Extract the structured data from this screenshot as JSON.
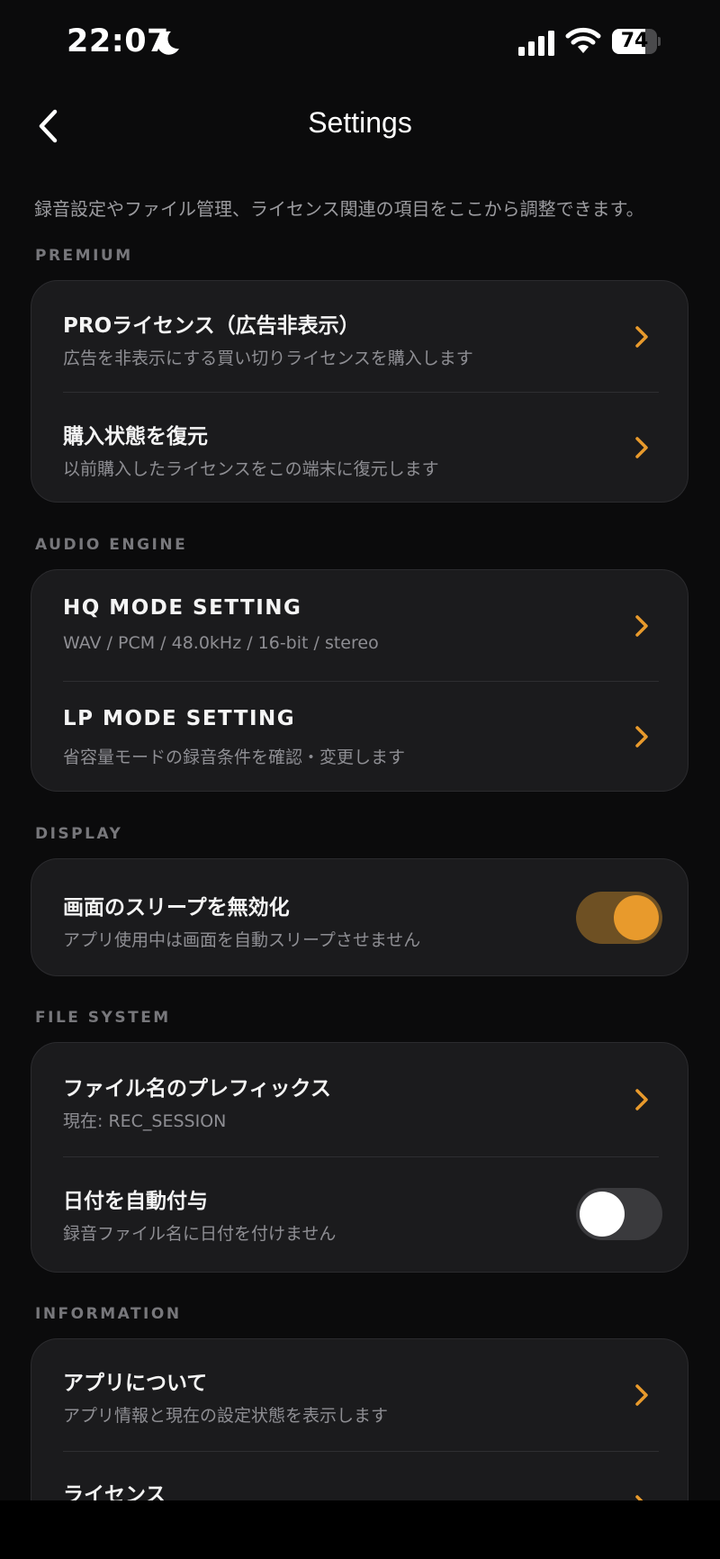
{
  "status_bar": {
    "time": "22:07",
    "battery_level": "74",
    "icons": [
      "moon-icon",
      "signal-icon",
      "wifi-icon",
      "battery-icon"
    ]
  },
  "nav": {
    "title": "Settings",
    "back_icon": "chevron-left-icon"
  },
  "description": "録音設定やファイル管理、ライセンス関連の項目をここから調整できます。",
  "colors": {
    "accent": "#e89a2c",
    "toggle_on_track": "#6e5023",
    "toggle_off_track": "#3a3a3d",
    "background": "#0b0b0c",
    "card": "#1b1b1d"
  },
  "sections": {
    "premium": {
      "label": "PREMIUM",
      "items": [
        {
          "title": "PROライセンス（広告非表示）",
          "subtitle": "広告を非表示にする買い切りライセンスを購入します"
        },
        {
          "title": "購入状態を復元",
          "subtitle": "以前購入したライセンスをこの端末に復元します"
        }
      ]
    },
    "audio_engine": {
      "label": "AUDIO ENGINE",
      "items": [
        {
          "title": "HQ MODE SETTING",
          "subtitle": "WAV / PCM / 48.0kHz / 16-bit / stereo"
        },
        {
          "title": "LP MODE SETTING",
          "subtitle": "省容量モードの録音条件を確認・変更します"
        }
      ]
    },
    "display": {
      "label": "DISPLAY",
      "items": [
        {
          "title": "画面のスリープを無効化",
          "subtitle": "アプリ使用中は画面を自動スリープさせません",
          "toggle_on": true
        }
      ]
    },
    "file_system": {
      "label": "FILE SYSTEM",
      "items": [
        {
          "title": "ファイル名のプレフィックス",
          "subtitle": "現在: REC_SESSION"
        },
        {
          "title": "日付を自動付与",
          "subtitle": "録音ファイル名に日付を付けません",
          "toggle_on": false
        }
      ]
    },
    "information": {
      "label": "INFORMATION",
      "items": [
        {
          "title": "アプリについて",
          "subtitle": "アプリ情報と現在の設定状態を表示します"
        },
        {
          "title": "ライセンス",
          "subtitle": ""
        }
      ]
    }
  }
}
